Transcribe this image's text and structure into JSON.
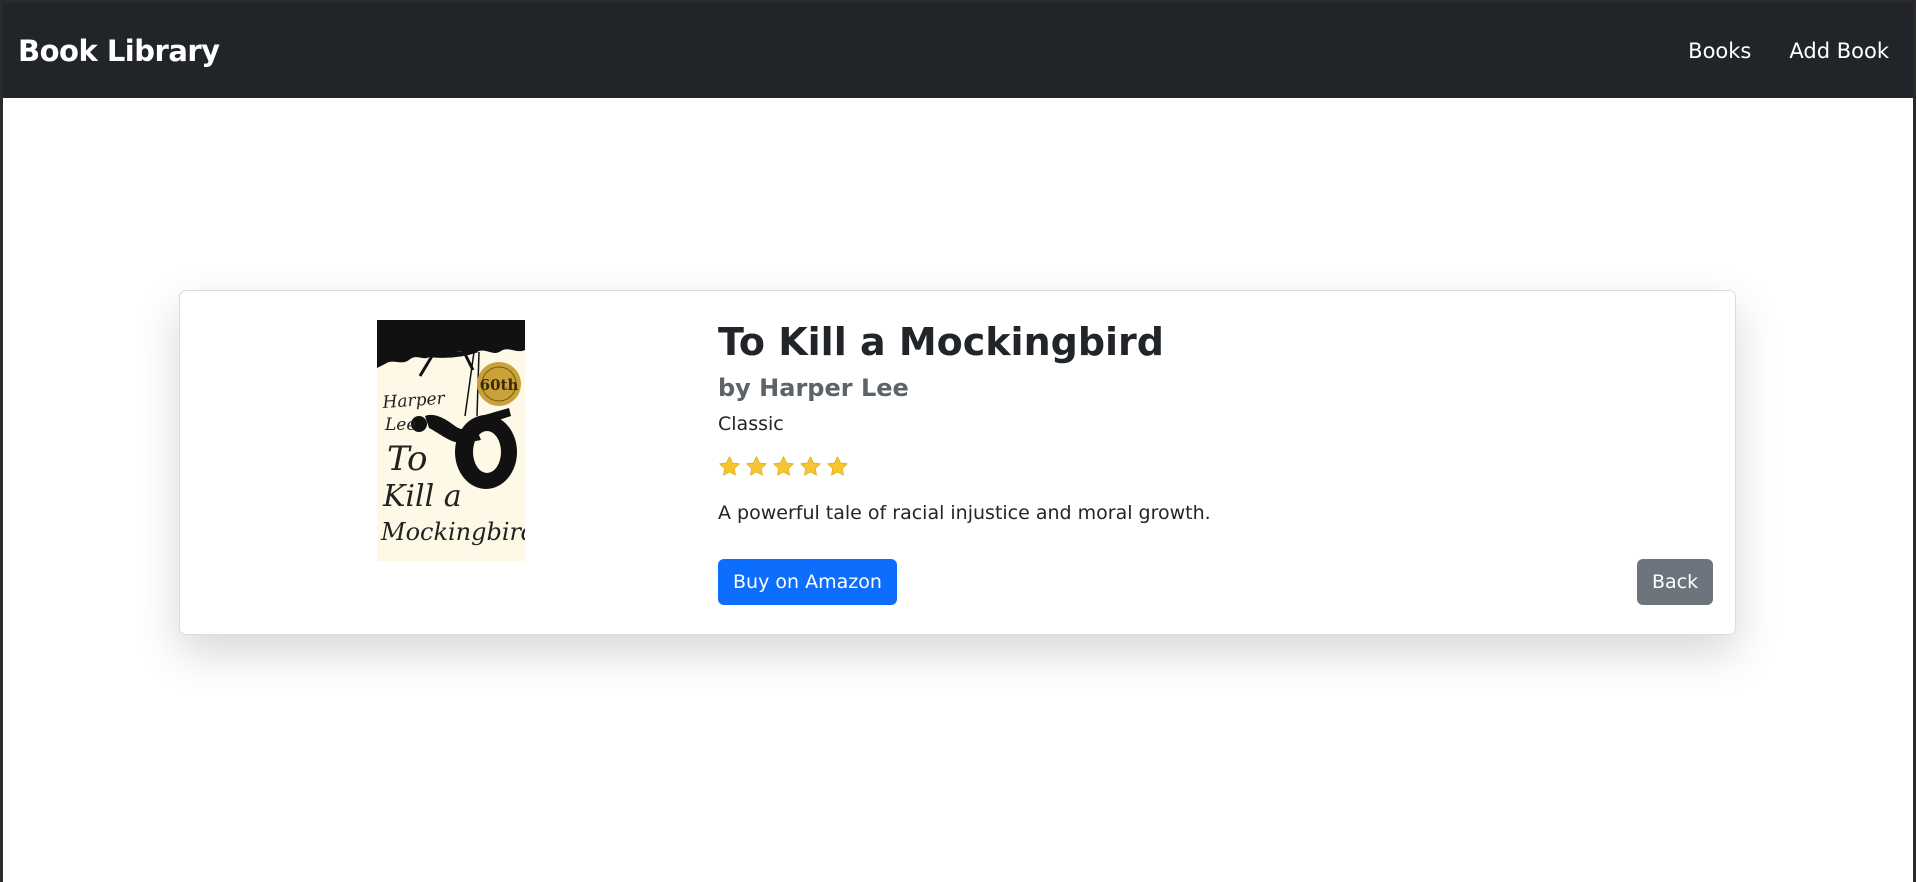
{
  "navbar": {
    "brand": "Book Library",
    "links": [
      {
        "label": "Books"
      },
      {
        "label": "Add Book"
      }
    ]
  },
  "book": {
    "title": "To Kill a Mockingbird",
    "author": "by Harper Lee",
    "genre": "Classic",
    "rating": 5,
    "rating_max": 5,
    "description": "A powerful tale of racial injustice and moral growth.",
    "cover": {
      "author_text": "Harper Lee",
      "title_text": "To Kill a Mockingbird",
      "badge_text": "60th"
    }
  },
  "actions": {
    "buy_label": "Buy on Amazon",
    "back_label": "Back"
  },
  "colors": {
    "navbar_bg": "#212529",
    "primary": "#0d6efd",
    "secondary": "#6c757d",
    "star": "#f6c531"
  },
  "icons": [
    "star-icon"
  ]
}
